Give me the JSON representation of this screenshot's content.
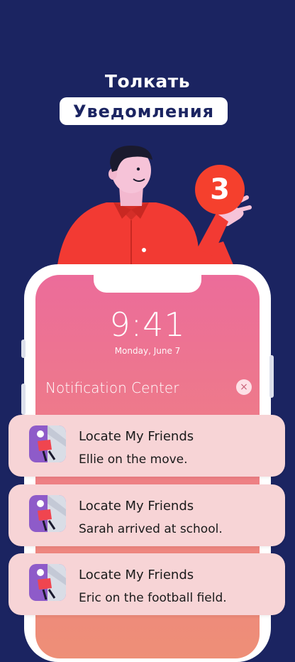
{
  "header": {
    "line1": "Толкать",
    "line2": "Уведомления"
  },
  "badge": {
    "count": "3"
  },
  "lockscreen": {
    "time": "9:41",
    "date": "Monday, June 7",
    "notification_center_title": "Notification Center",
    "close_glyph": "×"
  },
  "notifications": [
    {
      "app": "Locate My Friends",
      "message": "Ellie on the move."
    },
    {
      "app": "Locate My Friends",
      "message": "Sarah arrived at school."
    },
    {
      "app": "Locate My Friends",
      "message": "Eric on the football field."
    }
  ],
  "colors": {
    "background": "#1b2461",
    "badge": "#f5402d",
    "shirt": "#f23a33",
    "screen_top": "#ec6c9a",
    "screen_bottom": "#ee8f77",
    "notification_card": "#f7d4d6"
  }
}
